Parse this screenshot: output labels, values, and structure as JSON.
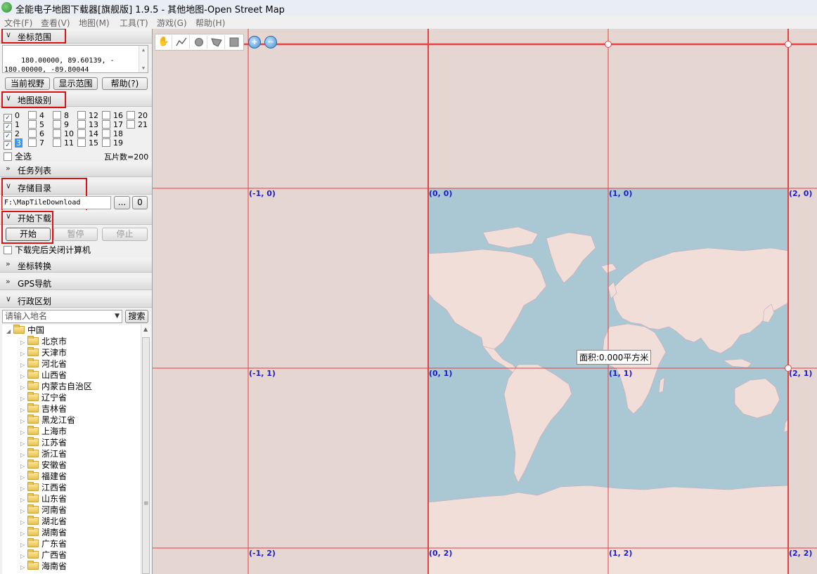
{
  "window": {
    "title": "全能电子地图下载器[旗舰版] 1.9.5 - 其他地图-Open Street Map"
  },
  "menu": [
    {
      "label": "文件(F)"
    },
    {
      "label": "查看(V)"
    },
    {
      "label": "地图(M)"
    },
    {
      "label": "工具(T)"
    },
    {
      "label": "游戏(G)"
    },
    {
      "label": "帮助(H)"
    }
  ],
  "panel": {
    "coord": {
      "header": "坐标范围",
      "value": "180.00000, 89.60139, -\n180.00000, -89.80044",
      "buttons": [
        "当前视野",
        "显示范围",
        "帮助(?)"
      ]
    },
    "levels": {
      "header": "地图级别",
      "items": [
        {
          "label": "0",
          "checked": true
        },
        {
          "label": "1",
          "checked": true
        },
        {
          "label": "2",
          "checked": true
        },
        {
          "label": "3",
          "checked": true
        },
        {
          "label": "4",
          "checked": false
        },
        {
          "label": "5",
          "checked": false
        },
        {
          "label": "6",
          "checked": false
        },
        {
          "label": "7",
          "checked": false
        },
        {
          "label": "8",
          "checked": false
        },
        {
          "label": "9",
          "checked": false
        },
        {
          "label": "10",
          "checked": false
        },
        {
          "label": "11",
          "checked": false
        },
        {
          "label": "12",
          "checked": false
        },
        {
          "label": "13",
          "checked": false
        },
        {
          "label": "14",
          "checked": false
        },
        {
          "label": "15",
          "checked": false
        },
        {
          "label": "16",
          "checked": false
        },
        {
          "label": "17",
          "checked": false
        },
        {
          "label": "18",
          "checked": false
        },
        {
          "label": "19",
          "checked": false
        },
        {
          "label": "20",
          "checked": false
        },
        {
          "label": "21",
          "checked": false
        }
      ],
      "select_all": "全选",
      "tile_count": "瓦片数=200"
    },
    "tasks": {
      "header": "任务列表"
    },
    "storage": {
      "header": "存储目录",
      "path": "F:\\MapTileDownload",
      "browse": "...",
      "open": "0"
    },
    "download": {
      "header": "开始下载",
      "start": "开始",
      "pause": "暂停",
      "stop": "停止",
      "shutdown": "下载完后关闭计算机"
    },
    "convert": {
      "header": "坐标转换"
    },
    "gps": {
      "header": "GPS导航"
    },
    "admin": {
      "header": "行政区划",
      "search_placeholder": "请输入地名",
      "search_button": "搜索",
      "root": "中国",
      "provinces": [
        "北京市",
        "天津市",
        "河北省",
        "山西省",
        "内蒙古自治区",
        "辽宁省",
        "吉林省",
        "黑龙江省",
        "上海市",
        "江苏省",
        "浙江省",
        "安徽省",
        "福建省",
        "江西省",
        "山东省",
        "河南省",
        "湖北省",
        "湖南省",
        "广东省",
        "广西省",
        "海南省"
      ]
    }
  },
  "map": {
    "tiles": [
      "(-1, 0)",
      "(0, 0)",
      "(1, 0)",
      "(2, 0)",
      "(-1, 1)",
      "(0, 1)",
      "(1, 1)",
      "(2, 1)",
      "(-1, 2)",
      "(0, 2)",
      "(1, 2)",
      "(2, 2)"
    ],
    "area": "面积:0.000平方米",
    "colors": {
      "ocean": "#aac8d4",
      "land": "#f2ded9",
      "grid": "#e84040",
      "tile_label": "#1a1ad0"
    }
  }
}
